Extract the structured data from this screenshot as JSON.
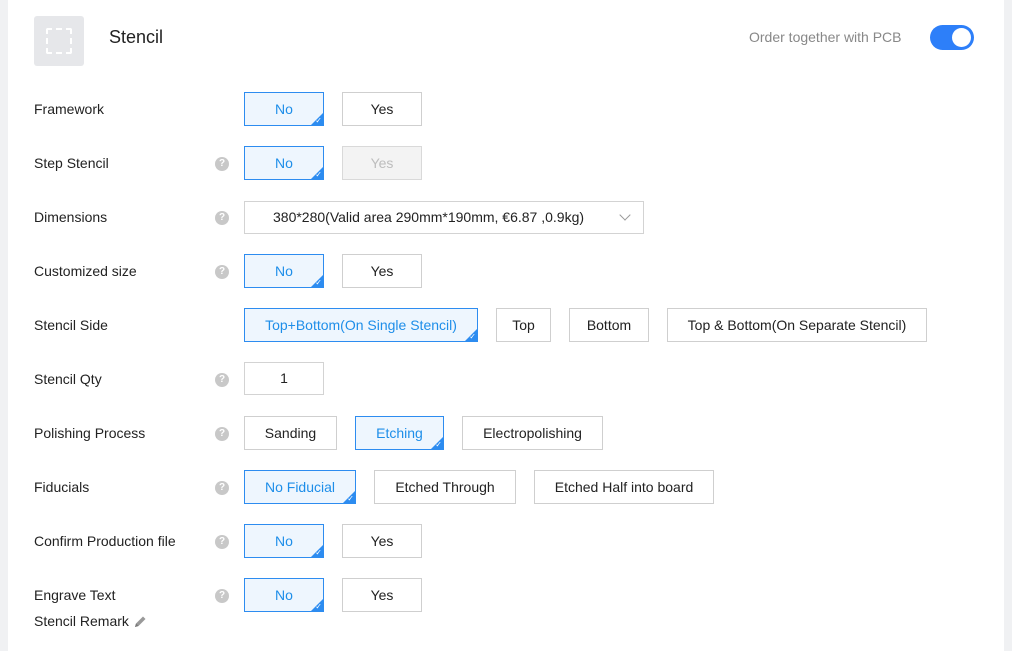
{
  "header": {
    "title": "Stencil",
    "order_together_label": "Order together with PCB",
    "order_together_enabled": true
  },
  "colors": {
    "accent": "#2d8cf0",
    "toggle_on": "#2d7ff9",
    "selected_bg": "#eef6fe"
  },
  "rows": {
    "framework": {
      "label": "Framework",
      "options": [
        "No",
        "Yes"
      ],
      "selected": "No"
    },
    "step_stencil": {
      "label": "Step Stencil",
      "options": [
        "No",
        "Yes"
      ],
      "selected": "No",
      "disabled": [
        "Yes"
      ]
    },
    "dimensions": {
      "label": "Dimensions",
      "value": "380*280(Valid area 290mm*190mm, €6.87 ,0.9kg)"
    },
    "customized_size": {
      "label": "Customized size",
      "options": [
        "No",
        "Yes"
      ],
      "selected": "No"
    },
    "stencil_side": {
      "label": "Stencil Side",
      "options": [
        "Top+Bottom(On Single Stencil)",
        "Top",
        "Bottom",
        "Top & Bottom(On Separate Stencil)"
      ],
      "selected": "Top+Bottom(On Single Stencil)"
    },
    "stencil_qty": {
      "label": "Stencil Qty",
      "value": "1"
    },
    "polishing_process": {
      "label": "Polishing Process",
      "options": [
        "Sanding",
        "Etching",
        "Electropolishing"
      ],
      "selected": "Etching"
    },
    "fiducials": {
      "label": "Fiducials",
      "options": [
        "No Fiducial",
        "Etched Through",
        "Etched Half into board"
      ],
      "selected": "No Fiducial"
    },
    "confirm_production_file": {
      "label": "Confirm Production file",
      "options": [
        "No",
        "Yes"
      ],
      "selected": "No"
    },
    "engrave_text": {
      "label": "Engrave Text",
      "options": [
        "No",
        "Yes"
      ],
      "selected": "No"
    }
  },
  "stencil_remark": {
    "label": "Stencil Remark"
  },
  "help_glyph": "?"
}
